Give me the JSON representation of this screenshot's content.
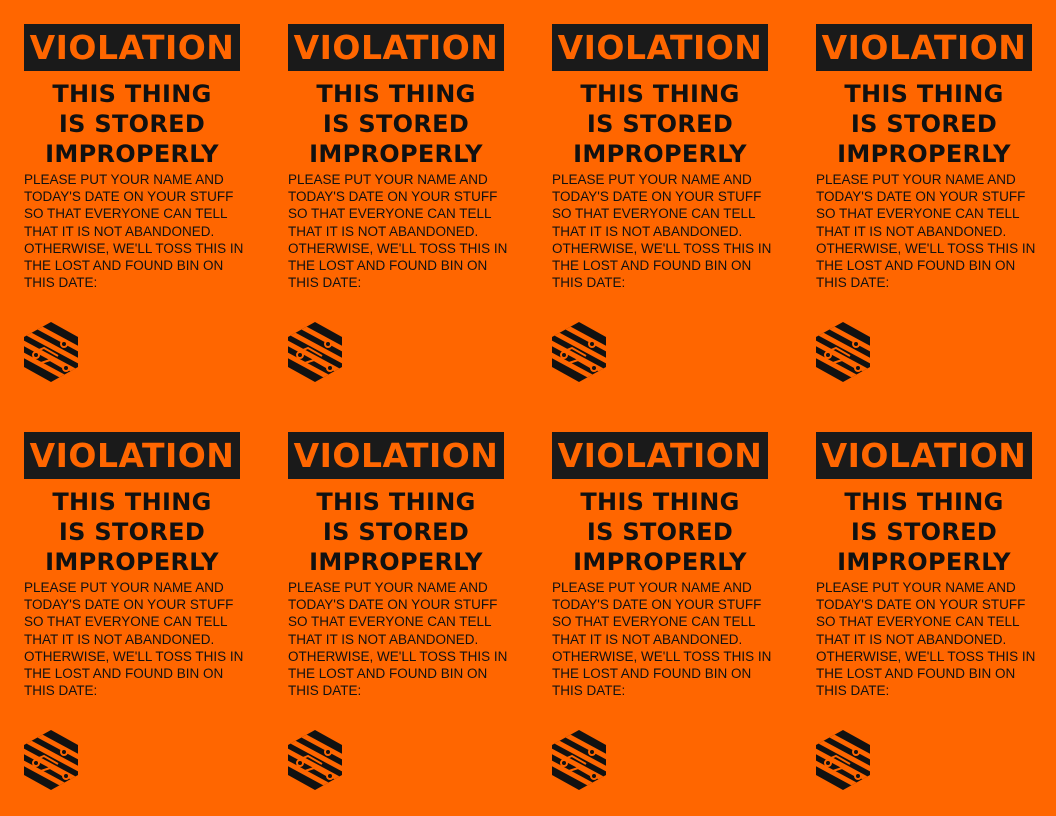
{
  "labels": [
    {
      "banner": "VIOLATION",
      "headline": [
        "THIS THING",
        "IS STORED",
        "IMPROPERLY"
      ],
      "body": [
        "PLEASE PUT YOUR NAME AND",
        "TODAY'S DATE ON YOUR STUFF",
        "SO THAT EVERYONE CAN TELL",
        "THAT IT IS NOT ABANDONED.",
        "OTHERWISE, WE'LL TOSS THIS IN",
        "THE LOST AND FOUND BIN ON",
        "THIS DATE:"
      ]
    },
    {
      "banner": "VIOLATION",
      "headline": [
        "THIS THING",
        "IS STORED",
        "IMPROPERLY"
      ],
      "body": [
        "PLEASE PUT YOUR NAME AND",
        "TODAY'S DATE ON YOUR STUFF",
        "SO THAT EVERYONE CAN TELL",
        "THAT IT IS NOT ABANDONED.",
        "OTHERWISE, WE'LL TOSS THIS IN",
        "THE LOST AND FOUND BIN ON",
        "THIS DATE:"
      ]
    },
    {
      "banner": "VIOLATION",
      "headline": [
        "THIS THING",
        "IS STORED",
        "IMPROPERLY"
      ],
      "body": [
        "PLEASE PUT YOUR NAME AND",
        "TODAY'S DATE ON YOUR STUFF",
        "SO THAT EVERYONE CAN TELL",
        "THAT IT IS NOT ABANDONED.",
        "OTHERWISE, WE'LL TOSS THIS IN",
        "THE LOST AND FOUND BIN ON",
        "THIS DATE:"
      ]
    },
    {
      "banner": "VIOLATION",
      "headline": [
        "THIS THING",
        "IS STORED",
        "IMPROPERLY"
      ],
      "body": [
        "PLEASE PUT YOUR NAME AND",
        "TODAY'S DATE ON YOUR STUFF",
        "SO THAT EVERYONE CAN TELL",
        "THAT IT IS NOT ABANDONED.",
        "OTHERWISE, WE'LL TOSS THIS IN",
        "THE LOST AND FOUND BIN ON",
        "THIS DATE:"
      ]
    },
    {
      "banner": "VIOLATION",
      "headline": [
        "THIS THING",
        "IS STORED",
        "IMPROPERLY"
      ],
      "body": [
        "PLEASE PUT YOUR NAME AND",
        "TODAY'S DATE ON YOUR STUFF",
        "SO THAT EVERYONE CAN TELL",
        "THAT IT IS NOT ABANDONED.",
        "OTHERWISE, WE'LL TOSS THIS IN",
        "THE LOST AND FOUND BIN ON",
        "THIS DATE:"
      ]
    },
    {
      "banner": "VIOLATION",
      "headline": [
        "THIS THING",
        "IS STORED",
        "IMPROPERLY"
      ],
      "body": [
        "PLEASE PUT YOUR NAME AND",
        "TODAY'S DATE ON YOUR STUFF",
        "SO THAT EVERYONE CAN TELL",
        "THAT IT IS NOT ABANDONED.",
        "OTHERWISE, WE'LL TOSS THIS IN",
        "THE LOST AND FOUND BIN ON",
        "THIS DATE:"
      ]
    },
    {
      "banner": "VIOLATION",
      "headline": [
        "THIS THING",
        "IS STORED",
        "IMPROPERLY"
      ],
      "body": [
        "PLEASE PUT YOUR NAME AND",
        "TODAY'S DATE ON YOUR STUFF",
        "SO THAT EVERYONE CAN TELL",
        "THAT IT IS NOT ABANDONED.",
        "OTHERWISE, WE'LL TOSS THIS IN",
        "THE LOST AND FOUND BIN ON",
        "THIS DATE:"
      ]
    },
    {
      "banner": "VIOLATION",
      "headline": [
        "THIS THING",
        "IS STORED",
        "IMPROPERLY"
      ],
      "body": [
        "PLEASE PUT YOUR NAME AND",
        "TODAY'S DATE ON YOUR STUFF",
        "SO THAT EVERYONE CAN TELL",
        "THAT IT IS NOT ABANDONED.",
        "OTHERWISE, WE'LL TOSS THIS IN",
        "THE LOST AND FOUND BIN ON",
        "THIS DATE:"
      ]
    }
  ],
  "logo_icon": "circuit-hexagon-logo",
  "colors": {
    "background": "#ff6600",
    "banner": "#1a1a1a",
    "text": "#111111"
  }
}
